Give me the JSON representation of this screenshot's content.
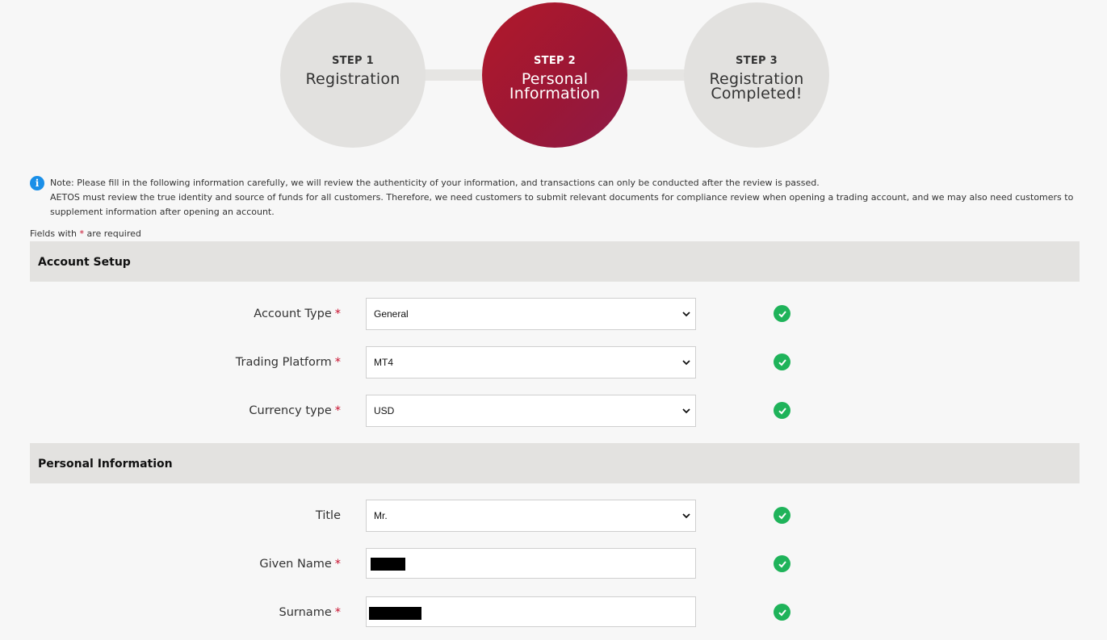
{
  "stepper": {
    "steps": [
      {
        "number": "STEP 1",
        "name_line1": "Registration",
        "name_line2": ""
      },
      {
        "number": "STEP 2",
        "name_line1": "Personal",
        "name_line2": "Information"
      },
      {
        "number": "STEP 3",
        "name_line1": "Registration",
        "name_line2": "Completed!"
      }
    ],
    "active_step": 2
  },
  "note": {
    "line1": "Note: Please fill in the following information carefully, we will review the authenticity of your information, and transactions can only be conducted after the review is passed.",
    "line2": "AETOS must review the true identity and source of funds for all customers. Therefore, we need customers to submit relevant documents for compliance review when opening a trading account, and we may also need customers to supplement information after opening an account."
  },
  "required_hint": {
    "prefix": "Fields with",
    "star": "*",
    "suffix": "are required"
  },
  "sections": {
    "account_setup": {
      "title": "Account Setup",
      "fields": [
        {
          "label": "Account Type",
          "required": "*",
          "value": "General"
        },
        {
          "label": "Trading Platform",
          "required": "*",
          "value": "MT4"
        },
        {
          "label": "Currency type",
          "required": "*",
          "value": "USD"
        }
      ]
    },
    "personal_information": {
      "title": "Personal Information",
      "fields": [
        {
          "label": "Title",
          "required": "",
          "value": "Mr."
        },
        {
          "label": "Given Name",
          "required": "*",
          "value": ""
        },
        {
          "label": "Surname",
          "required": "*",
          "value": ""
        }
      ]
    }
  },
  "colors": {
    "accent": "#a01730",
    "valid": "#1fb35a",
    "info": "#1a8fe8",
    "required": "#c8102e"
  },
  "icons": {
    "info": "info-icon",
    "valid": "check-circle-icon",
    "dropdown": "chevron-down-icon"
  }
}
